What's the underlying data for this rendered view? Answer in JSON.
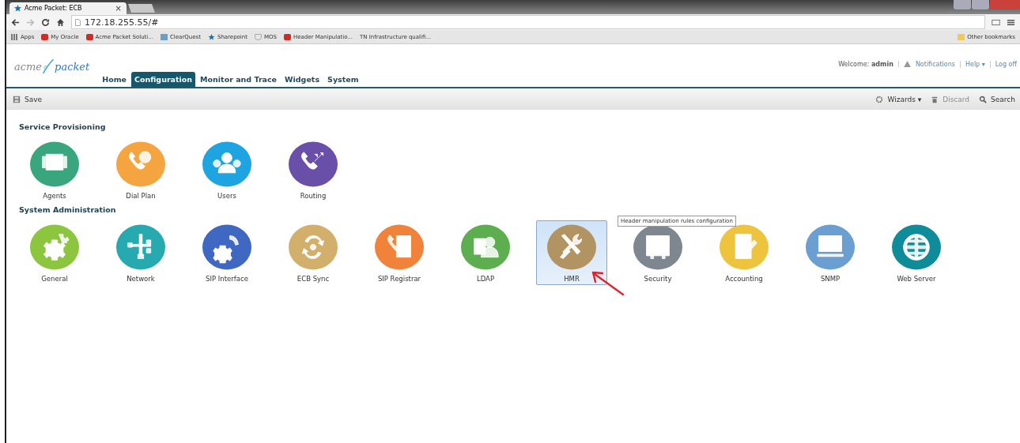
{
  "browser": {
    "tab_title": "Acme Packet: ECB",
    "tab_close": "×",
    "address": "172.18.255.55/#",
    "bookmarks": [
      {
        "label": "Apps",
        "kind": "apps"
      },
      {
        "label": "My Oracle",
        "kind": "oracle"
      },
      {
        "label": "Acme Packet Soluti...",
        "kind": "oracle"
      },
      {
        "label": "ClearQuest",
        "kind": "database"
      },
      {
        "label": "Sharepoint",
        "kind": "star"
      },
      {
        "label": "MOS",
        "kind": "shield"
      },
      {
        "label": "Header Manipulatio...",
        "kind": "oracle"
      },
      {
        "label": "TN Infrastructure qualifi...",
        "kind": "none"
      }
    ],
    "other_bookmarks": "Other bookmarks"
  },
  "header": {
    "logo_left": "acme",
    "logo_right": "packet",
    "welcome": "Welcome: **admin**",
    "links": [
      "Notifications",
      "Help ▾",
      "Log off"
    ],
    "nav": [
      {
        "label": "Home",
        "selected": false
      },
      {
        "label": "Configuration",
        "selected": true
      },
      {
        "label": "Monitor and Trace",
        "selected": false
      },
      {
        "label": "Widgets",
        "selected": false
      },
      {
        "label": "System",
        "selected": false
      }
    ]
  },
  "toolbar": {
    "save": "Save",
    "wizards": "Wizards ▾",
    "discard": {
      "label": "Discard",
      "disabled": true
    },
    "search": "Search"
  },
  "sections": [
    {
      "title": "Service Provisioning",
      "tiles": [
        {
          "label": "Agents",
          "color": "#3aa67f",
          "selected": false
        },
        {
          "label": "Dial Plan",
          "color": "#f4a540",
          "selected": false
        },
        {
          "label": "Users",
          "color": "#1ea4e0",
          "selected": false
        },
        {
          "label": "Routing",
          "color": "#6a4fa8",
          "selected": false
        }
      ]
    },
    {
      "title": "System Administration",
      "tiles": [
        {
          "label": "General",
          "color": "#8cc63f",
          "selected": false
        },
        {
          "label": "Network",
          "color": "#26aab0",
          "selected": false
        },
        {
          "label": "SIP Interface",
          "color": "#3f68c3",
          "selected": false
        },
        {
          "label": "ECB Sync",
          "color": "#d2b06c",
          "selected": false
        },
        {
          "label": "SIP Registrar",
          "color": "#f0823a",
          "selected": false
        },
        {
          "label": "LDAP",
          "color": "#5cae4f",
          "selected": false
        },
        {
          "label": "HMR",
          "color": "#b29463",
          "selected": true,
          "tooltip": "Header manipulation rules configuration"
        },
        {
          "label": "Security",
          "color": "#7e8790",
          "selected": false
        },
        {
          "label": "Accounting",
          "color": "#eec43f",
          "selected": false
        },
        {
          "label": "SNMP",
          "color": "#6b9fd1",
          "selected": false
        },
        {
          "label": "Web Server",
          "color": "#0f8c9a",
          "selected": false
        }
      ]
    }
  ]
}
